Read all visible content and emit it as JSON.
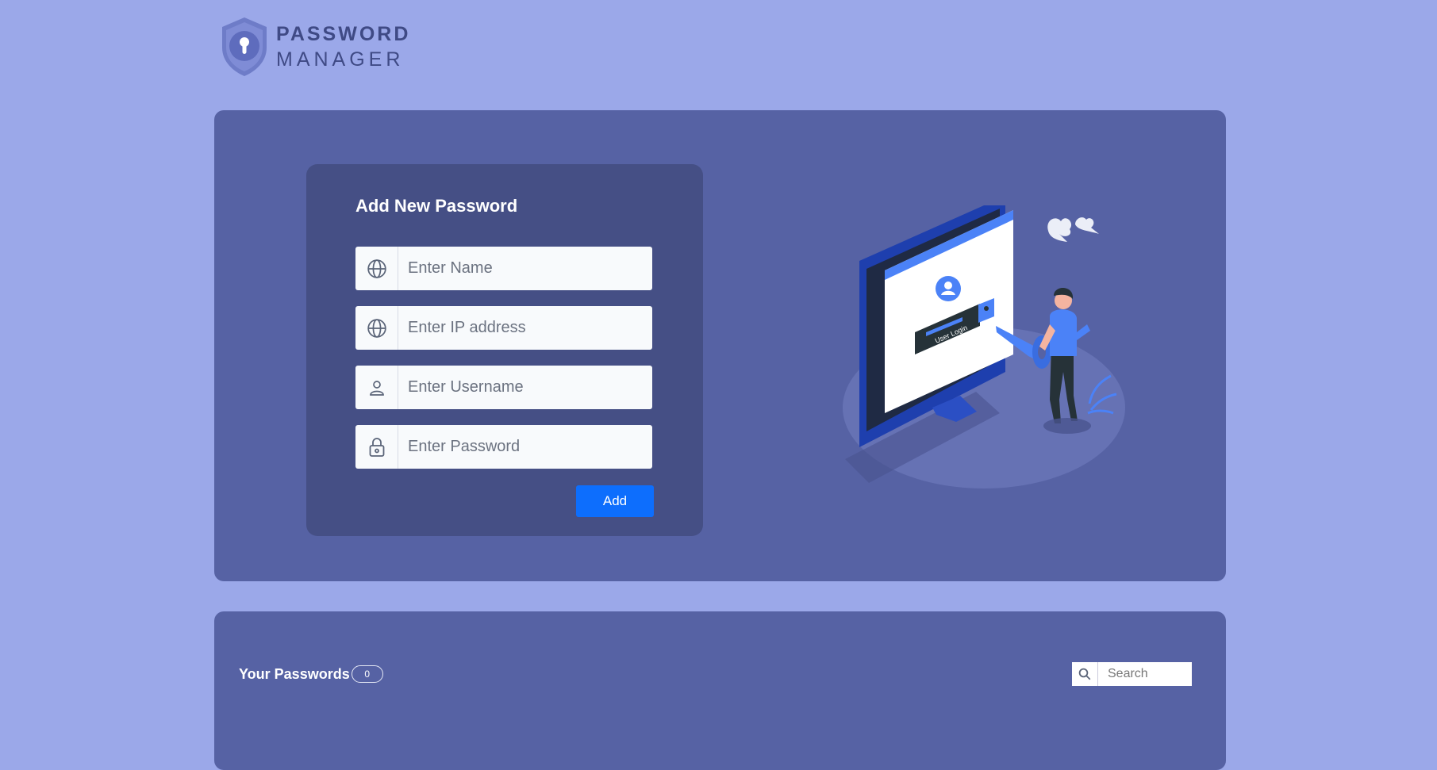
{
  "logo": {
    "line1": "PASSWORD",
    "line2": "MANAGER"
  },
  "form": {
    "title": "Add New Password",
    "fields": [
      {
        "icon": "globe-icon",
        "placeholder": "Enter Name"
      },
      {
        "icon": "globe-icon",
        "placeholder": "Enter IP address"
      },
      {
        "icon": "user-icon",
        "placeholder": "Enter Username"
      },
      {
        "icon": "lock-icon",
        "placeholder": "Enter Password"
      }
    ],
    "add_label": "Add"
  },
  "illustration": {
    "screen_text": "User Login"
  },
  "passwords": {
    "title": "Your Passwords",
    "count": "0"
  },
  "search": {
    "placeholder": "Search"
  },
  "colors": {
    "background": "#9ba8e9",
    "panel": "#5662a4",
    "card": "#454f85",
    "accent": "#0d6efd"
  }
}
